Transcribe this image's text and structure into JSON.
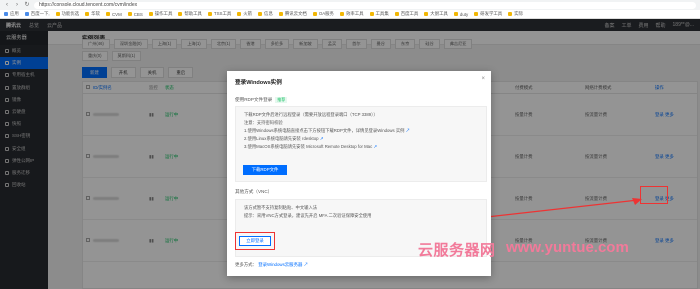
{
  "browser": {
    "url": "https://console.cloud.tencent.com/cvm/index",
    "bookmarks": [
      "应用",
      "百度一下,",
      "功能优选",
      "华软",
      "CVM",
      "CBS",
      "操作工具",
      "帮助工具",
      "TSS工具",
      "火箭",
      "信息",
      "腾讯云文档",
      "OA服务",
      "效率工具",
      "工具集",
      "百度工具",
      "大厨工具",
      "duty",
      "研发学工具",
      "实际"
    ]
  },
  "topbar": {
    "logo": "腾讯云",
    "nav": [
      "总览",
      "云产品"
    ],
    "right": [
      "备案",
      "工单",
      "费用",
      "帮助",
      "189**@..."
    ]
  },
  "sidebar": {
    "title": "云服务器",
    "items": [
      "概览",
      "实例",
      "专用宿主机",
      "置放群组",
      "镜像",
      "云硬盘",
      "快照",
      "SSH密钥",
      "安全组",
      "弹性公网IP",
      "服务迁移",
      "回收站"
    ],
    "active_index": 1
  },
  "main": {
    "title": "实例列表",
    "regions": [
      "广州(46)",
      "深圳金融(0)",
      "上海(1)",
      "上海(1)",
      "北京(1)",
      "香港",
      "多伦多",
      "新加坡",
      "孟买",
      "首尔",
      "曼谷",
      "东京",
      "硅谷",
      "弗吉尼亚"
    ],
    "regions_row2": [
      "重庆(0)",
      "莫斯科(1)"
    ],
    "toolbar": [
      "新建",
      "开机",
      "关机",
      "重启"
    ],
    "table_header": [
      "ID/实例名",
      "监控",
      "状态",
      "付费模式",
      "网络计费模式",
      "操作"
    ],
    "rows": [
      {
        "status": "运行中",
        "pay": "按量计费",
        "net": "按流量计费",
        "ops": "登录 更多"
      },
      {
        "status": "运行中",
        "pay": "按量计费",
        "net": "按流量计费",
        "ops": "登录 更多"
      },
      {
        "status": "运行中",
        "pay": "按量计费",
        "net": "按流量计费",
        "ops": "登录 更多"
      },
      {
        "status": "运行中",
        "pay": "按量计费",
        "net": "按流量计费",
        "ops": "登录 更多"
      }
    ]
  },
  "modal": {
    "title": "登录Windows实例",
    "close": "×",
    "rdp_section": "使用RDP文件登录",
    "rdp_tag": "推荐",
    "rdp_lines": [
      "下载RDP文件后进行远程登录（需要开放远程登录端口（TCP 3389））",
      "注意：支持密码校验",
      "1.使用Windows系统电脑直接点击下方按钮下载RDP文件，详情见登录Windows 实例",
      "2.使用Linux系统电脑请先安装 rdesktop",
      "3.使用MacOS系统电脑请先安装 Microsoft Remote Desktop for Mac"
    ],
    "download_button": "下载RDP文件",
    "vnc_section": "其他方式（VNC）",
    "vnc_lines": [
      "该方式暂不支持复制粘贴、中文输入法",
      "提示：采用VNC方式登录，建议先开启 MFA 二次验证保障安全使用"
    ],
    "vnc_button": "立即登录",
    "more_label": "更多方式：",
    "more_link": "登录Windows云服务器"
  },
  "watermark": {
    "cn": "云服务器网",
    "url": "www.yuntue.com"
  },
  "colors": {
    "primary": "#006eff",
    "sidebar_bg": "#292c31",
    "highlight": "#e33333",
    "running": "#0abf5b"
  }
}
